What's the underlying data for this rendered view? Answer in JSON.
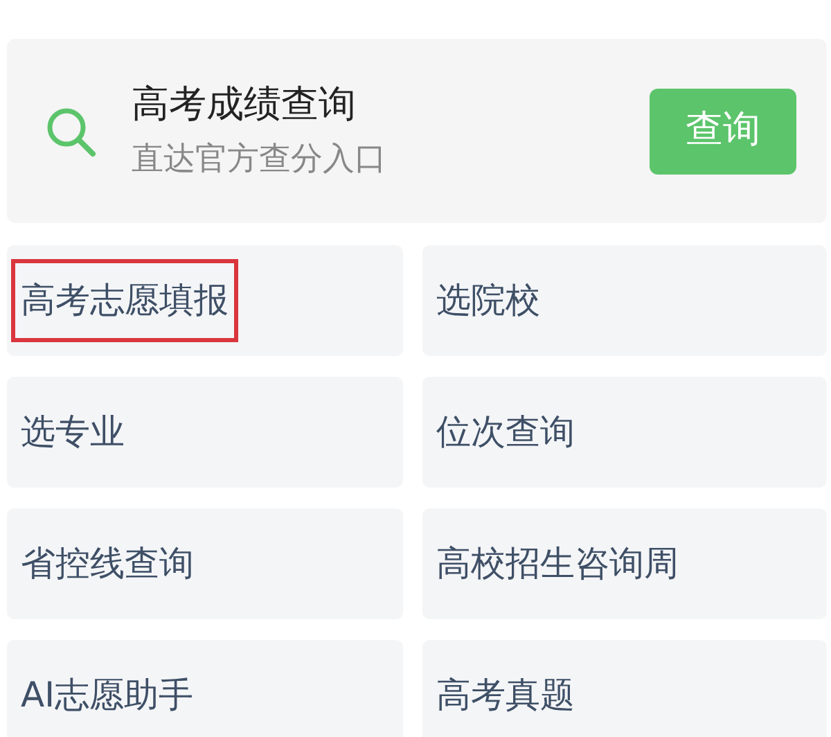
{
  "score_query": {
    "title": "高考成绩查询",
    "subtitle": "直达官方查分入口",
    "button": "查询"
  },
  "links": [
    {
      "label": "高考志愿填报",
      "highlighted": true
    },
    {
      "label": "选院校",
      "highlighted": false
    },
    {
      "label": "选专业",
      "highlighted": false
    },
    {
      "label": "位次查询",
      "highlighted": false
    },
    {
      "label": "省控线查询",
      "highlighted": false
    },
    {
      "label": "高校招生咨询周",
      "highlighted": false
    },
    {
      "label": "AI志愿助手",
      "highlighted": false
    },
    {
      "label": "高考真题",
      "highlighted": false
    }
  ]
}
